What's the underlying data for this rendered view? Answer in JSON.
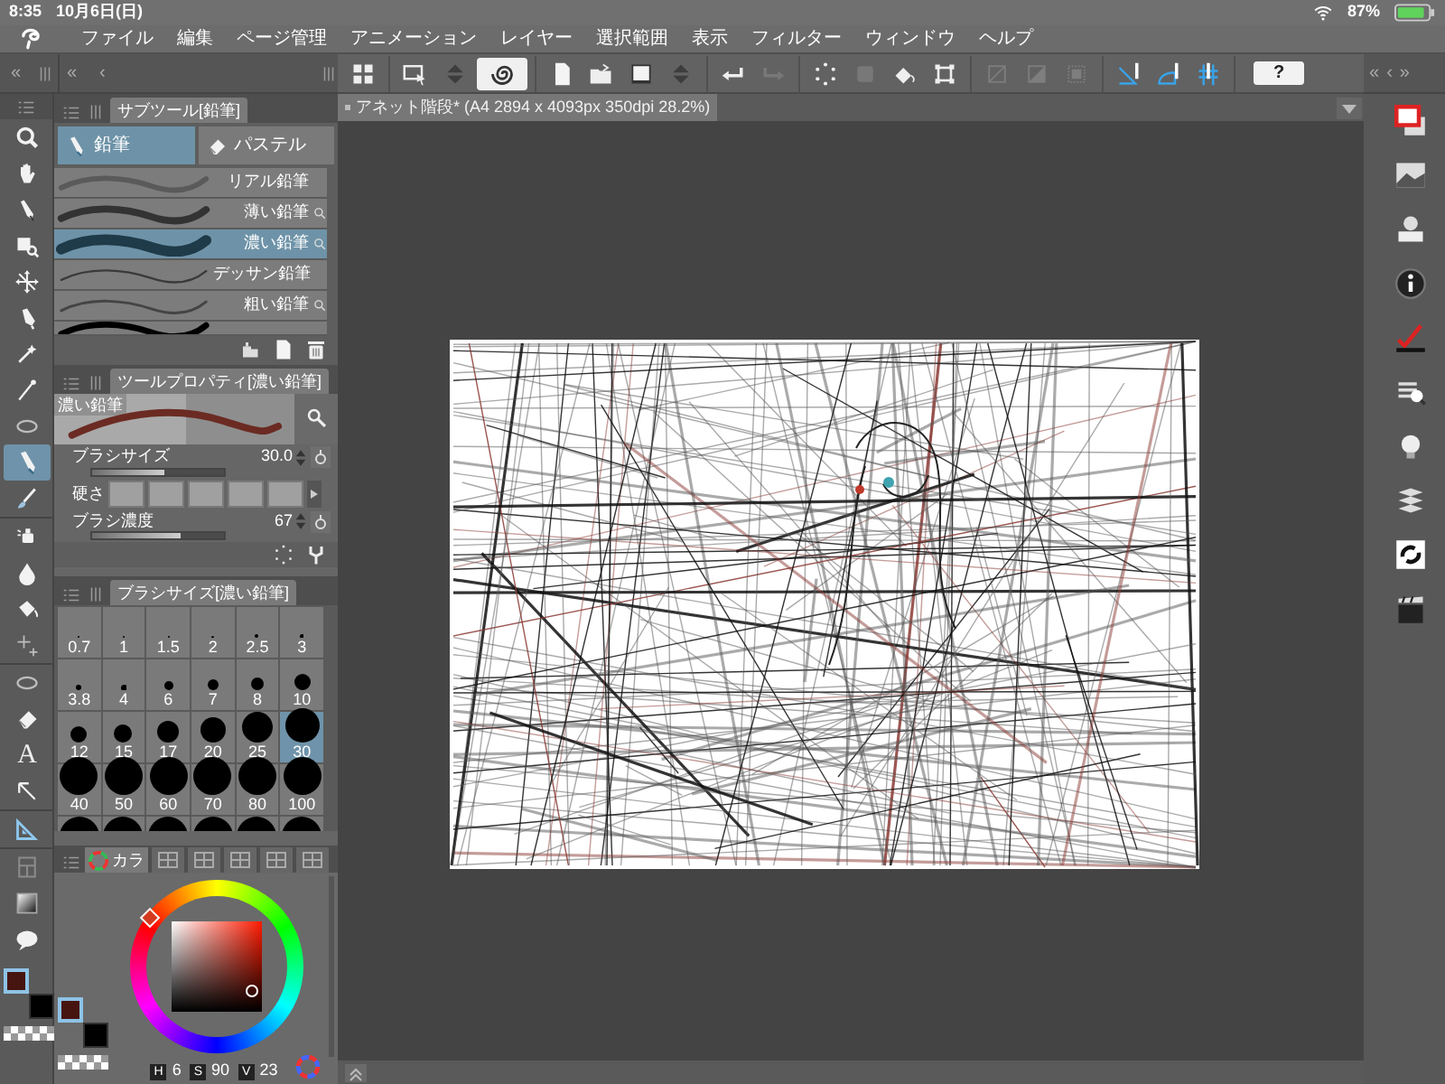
{
  "status_bar": {
    "time": "8:35",
    "date": "10月6日(日)",
    "battery": "87%"
  },
  "menu": [
    "ファイル",
    "編集",
    "ページ管理",
    "アニメーション",
    "レイヤー",
    "選択範囲",
    "表示",
    "フィルター",
    "ウィンドウ",
    "ヘルプ"
  ],
  "left_header": [
    "«",
    "«",
    "‹"
  ],
  "right_header": [
    "«",
    "‹",
    "»"
  ],
  "tool_strip": {
    "groups": [
      {
        "tools": [
          {
            "selected": false
          },
          {
            "selected": false
          },
          {
            "selected": false
          },
          {
            "selected": false
          },
          {
            "selected": false
          },
          {
            "selected": false
          },
          {
            "selected": false
          },
          {
            "selected": false
          },
          {
            "selected": false
          },
          {
            "selected": true
          },
          {
            "selected": false
          }
        ]
      },
      {
        "tools": [
          {
            "selected": false
          },
          {
            "selected": false
          },
          {
            "selected": false
          },
          {
            "selected": false
          }
        ]
      },
      {
        "tools": [
          {
            "selected": false
          },
          {
            "selected": false
          },
          {
            "selected": false,
            "label": "A"
          },
          {
            "selected": false
          }
        ]
      },
      {
        "tools": [
          {
            "selected": false
          }
        ]
      },
      {
        "tools": [
          {
            "selected": false
          },
          {
            "selected": false
          },
          {
            "selected": false
          }
        ]
      }
    ],
    "colors": [
      {
        "color": "#461510",
        "selected": true
      },
      {
        "color": "#000000",
        "selected": false
      }
    ]
  },
  "subtool_panel": {
    "title": "サブツール[鉛筆]",
    "groups": [
      {
        "label": "鉛筆",
        "selected": true
      },
      {
        "label": "パステル",
        "selected": false
      }
    ],
    "brushes": [
      {
        "name": "リアル鉛筆",
        "selected": false,
        "search_icon": false
      },
      {
        "name": "薄い鉛筆",
        "selected": false,
        "search_icon": true
      },
      {
        "name": "濃い鉛筆",
        "selected": true,
        "search_icon": true
      },
      {
        "name": "デッサン鉛筆",
        "selected": false,
        "search_icon": false
      },
      {
        "name": "粗い鉛筆",
        "selected": false,
        "search_icon": true
      },
      {
        "selected": false,
        "search_icon": false
      }
    ]
  },
  "tool_property": {
    "title": "ツールプロパティ[濃い鉛筆]",
    "preview_label": "濃い鉛筆",
    "brush_size": {
      "label": "ブラシサイズ",
      "value": "30.0",
      "level": 0.55
    },
    "hardness": {
      "label": "硬さ"
    },
    "density": {
      "label": "ブラシ濃度",
      "value": "67",
      "level": 0.67
    }
  },
  "brush_size_panel": {
    "title": "ブラシサイズ[濃い鉛筆]",
    "sizes": [
      {
        "label": "0.7",
        "selected": false
      },
      {
        "label": "1",
        "selected": false
      },
      {
        "label": "1.5",
        "selected": false
      },
      {
        "label": "2",
        "selected": false
      },
      {
        "label": "2.5",
        "selected": false
      },
      {
        "label": "3",
        "selected": false
      },
      {
        "label": "3.8",
        "selected": false
      },
      {
        "label": "4",
        "selected": false
      },
      {
        "label": "6",
        "selected": false
      },
      {
        "label": "7",
        "selected": false
      },
      {
        "label": "8",
        "selected": false
      },
      {
        "label": "10",
        "selected": false
      },
      {
        "label": "12",
        "selected": false
      },
      {
        "label": "15",
        "selected": false
      },
      {
        "label": "17",
        "selected": false
      },
      {
        "label": "20",
        "selected": false
      },
      {
        "label": "25",
        "selected": false
      },
      {
        "label": "30",
        "selected": true
      },
      {
        "label": "40",
        "selected": false
      },
      {
        "label": "50",
        "selected": false
      },
      {
        "label": "60",
        "selected": false
      },
      {
        "label": "70",
        "selected": false
      },
      {
        "label": "80",
        "selected": false
      },
      {
        "label": "100",
        "selected": false
      }
    ]
  },
  "color_panel": {
    "tabs": [
      {
        "kind": "text",
        "label": "カラ",
        "selected": true
      },
      {
        "kind": "icon",
        "selected": false
      },
      {
        "kind": "icon",
        "selected": false
      },
      {
        "kind": "icon",
        "selected": false
      },
      {
        "kind": "icon",
        "selected": false
      },
      {
        "kind": "icon",
        "selected": false
      }
    ],
    "colors": [
      {
        "color": "#461510",
        "selected": true
      },
      {
        "color": "#000000",
        "selected": false
      }
    ],
    "hsv": [
      {
        "label": "H",
        "value": "6"
      },
      {
        "label": "S",
        "value": "90"
      },
      {
        "label": "V",
        "value": "23"
      }
    ]
  },
  "toolbar": [
    {
      "on": false,
      "disabled": false
    },
    {
      "on": false,
      "disabled": false
    },
    {
      "on": false,
      "disabled": false
    },
    {
      "on": true,
      "disabled": false
    },
    {
      "on": false,
      "disabled": false
    },
    {
      "on": false,
      "disabled": false
    },
    {
      "on": false,
      "disabled": false
    },
    {
      "on": false,
      "disabled": false
    },
    {
      "on": false,
      "disabled": false
    },
    {
      "on": false,
      "disabled": true
    },
    {
      "on": false,
      "disabled": false
    },
    {
      "on": false,
      "disabled": true
    },
    {
      "on": false,
      "disabled": false
    },
    {
      "on": false,
      "disabled": false
    },
    {
      "on": false,
      "disabled": true
    },
    {
      "on": false,
      "disabled": true
    },
    {
      "on": false,
      "disabled": true
    },
    {
      "on": false,
      "disabled": false
    },
    {
      "on": false,
      "disabled": false
    },
    {
      "on": false,
      "disabled": false
    }
  ],
  "help_button": "?",
  "document_tab": {
    "title": "アネット階段* (A4 2894 x 4093px 350dpi 28.2%)"
  }
}
